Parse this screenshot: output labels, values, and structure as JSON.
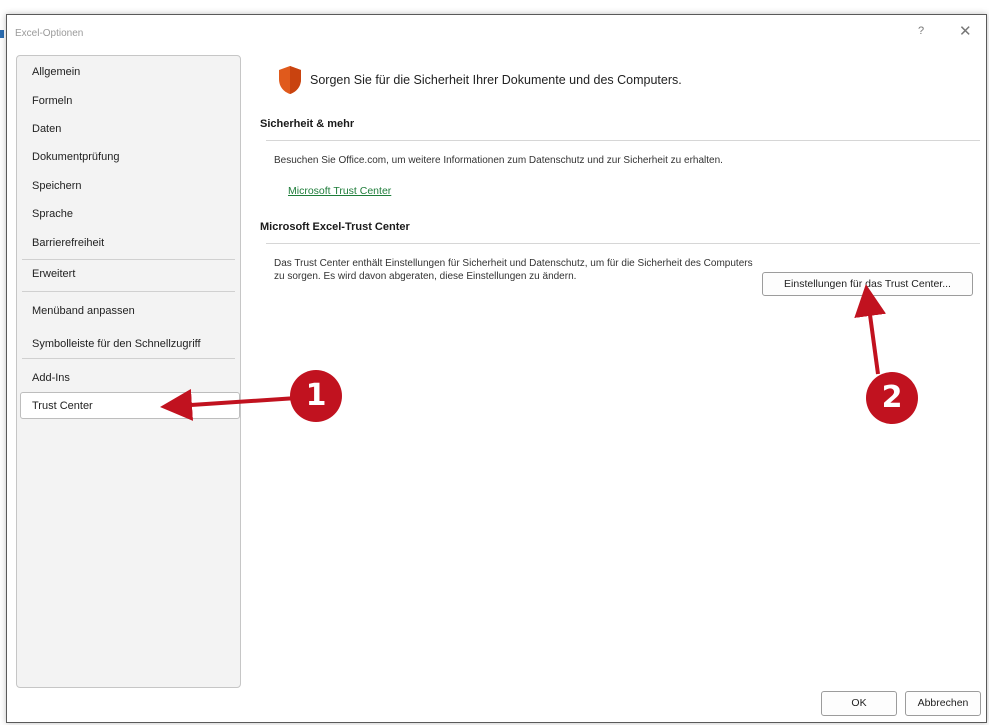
{
  "window": {
    "title": "Excel-Optionen",
    "help_glyph": "?",
    "close_glyph": "✕"
  },
  "sidebar": {
    "items": [
      {
        "label": "Allgemein"
      },
      {
        "label": "Formeln"
      },
      {
        "label": "Daten"
      },
      {
        "label": "Dokumentprüfung"
      },
      {
        "label": "Speichern"
      },
      {
        "label": "Sprache"
      },
      {
        "label": "Barrierefreiheit"
      },
      {
        "label": "Erweitert"
      },
      {
        "label": "Menüband anpassen"
      },
      {
        "label": "Symbolleiste für den Schnellzugriff"
      },
      {
        "label": "Add-Ins"
      },
      {
        "label": "Trust Center"
      }
    ],
    "selected": "Trust Center"
  },
  "main": {
    "headline": "Sorgen Sie für die Sicherheit Ihrer Dokumente und des Computers.",
    "section1": {
      "title": "Sicherheit & mehr",
      "text": "Besuchen Sie Office.com, um weitere Informationen zum Datenschutz und zur Sicherheit zu erhalten.",
      "link": "Microsoft Trust Center"
    },
    "section2": {
      "title": "Microsoft Excel-Trust Center",
      "text": "Das Trust Center enthält Einstellungen für Sicherheit und Datenschutz, um für die Sicherheit des Computers zu sorgen. Es wird davon abgeraten, diese Einstellungen zu ändern.",
      "button": "Einstellungen für das Trust Center..."
    }
  },
  "footer": {
    "ok": "OK",
    "cancel": "Abbrechen"
  },
  "annotations": {
    "marker1": "1",
    "marker2": "2",
    "color": "#c1121f"
  },
  "colors": {
    "shield": "#e05a1c",
    "link": "#1e7d3a"
  }
}
